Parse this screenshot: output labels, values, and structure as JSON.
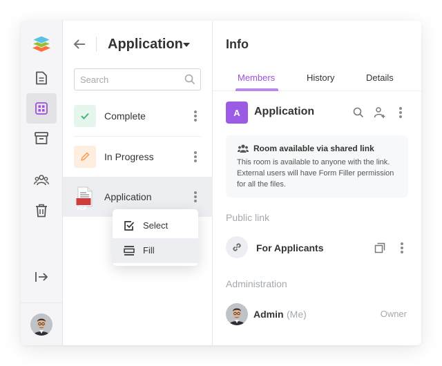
{
  "app": {
    "room_title": "Application",
    "search_placeholder": "Search"
  },
  "files": [
    {
      "label": "Complete",
      "icon": "checkmark-icon",
      "tile_color": "#e6f6ec",
      "icon_color": "#46b678"
    },
    {
      "label": "In Progress",
      "icon": "pencil-icon",
      "tile_color": "#fdeee0",
      "icon_color": "#f7a35c"
    },
    {
      "label": "Application",
      "icon": "pdf-file-icon",
      "tile_color": "#ffffff",
      "icon_color": "#d23b3b"
    }
  ],
  "pdf_badge": "PDF",
  "context_menu": {
    "items": [
      {
        "label": "Select",
        "icon": "checkbox-icon"
      },
      {
        "label": "Fill",
        "icon": "form-fill-icon"
      }
    ]
  },
  "info": {
    "title": "Info",
    "tabs": [
      {
        "label": "Members",
        "active": true
      },
      {
        "label": "History",
        "active": false
      },
      {
        "label": "Details",
        "active": false
      }
    ],
    "room": {
      "logo_letter": "A",
      "name": "Application",
      "logo_color": "#9c5be5"
    },
    "notice": {
      "title": "Room available via shared link",
      "body": "This room is available to anyone with the link. External users will have Form Filler permission for all the files."
    },
    "public_link_label": "Public link",
    "public_link_name": "For Applicants",
    "administration_label": "Administration",
    "admin": {
      "name": "Admin",
      "suffix": "(Me)",
      "role": "Owner"
    }
  },
  "colors": {
    "accent": "#9c4fdb",
    "muted_text": "#a3a9ae"
  }
}
